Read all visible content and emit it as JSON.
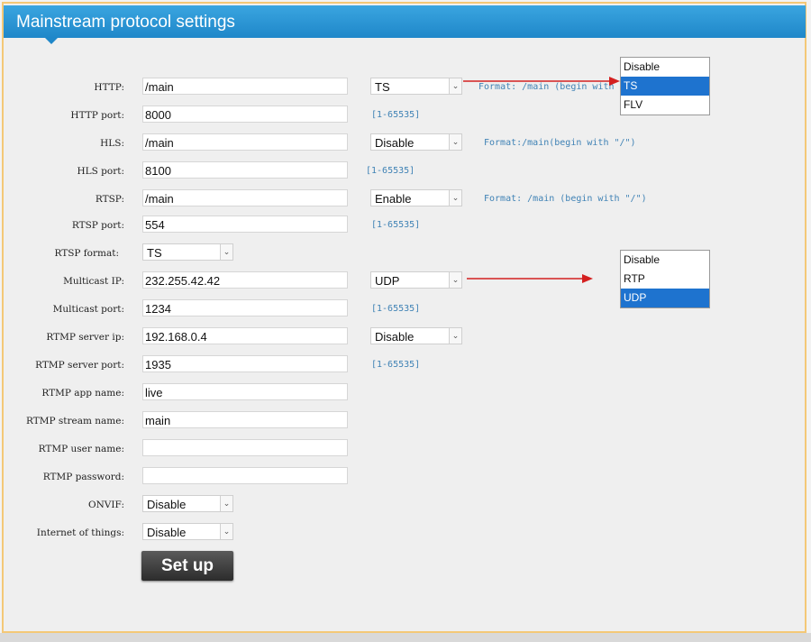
{
  "header": {
    "title": "Mainstream protocol settings"
  },
  "rows": [
    {
      "label": "HTTP:",
      "value": "/main"
    },
    {
      "label": "HTTP port:",
      "value": "8000"
    },
    {
      "label": "HLS:",
      "value": "/main"
    },
    {
      "label": "HLS port:",
      "value": "8100"
    },
    {
      "label": "RTSP:",
      "value": "/main"
    },
    {
      "label": "RTSP port:",
      "value": "554"
    },
    {
      "label": "RTSP format:",
      "value": "TS"
    },
    {
      "label": "Multicast IP:",
      "value": "232.255.42.42"
    },
    {
      "label": "Multicast port:",
      "value": "1234"
    },
    {
      "label": "RTMP server ip:",
      "value": "192.168.0.4"
    },
    {
      "label": "RTMP server port:",
      "value": "1935"
    },
    {
      "label": "RTMP app name:",
      "value": "live"
    },
    {
      "label": "RTMP stream name:",
      "value": "main"
    },
    {
      "label": "RTMP user name:",
      "value": ""
    },
    {
      "label": "RTMP password:",
      "value": ""
    },
    {
      "label": "ONVIF:",
      "value": "Disable"
    },
    {
      "label": "Internet of things:",
      "value": "Disable"
    }
  ],
  "selects": {
    "http_format": "TS",
    "hls_enable": "Disable",
    "rtsp_enable": "Enable",
    "multicast_proto": "UDP",
    "rtmp_enable": "Disable"
  },
  "hints": {
    "http": "Format: /main (begin with \"",
    "http_port": "[1-65535]",
    "hls": "Format:/main(begin with \"/\")",
    "hls_port": "[1-65535]",
    "rtsp": "Format: /main (begin with \"/\")",
    "rtsp_port": "[1-65535]",
    "multicast_port": "[1-65535]",
    "rtmp_port": "[1-65535]"
  },
  "dropdown_http": {
    "options": [
      "Disable",
      "TS",
      "FLV"
    ],
    "selected": "TS"
  },
  "dropdown_multicast": {
    "options": [
      "Disable",
      "RTP",
      "UDP"
    ],
    "selected": "UDP"
  },
  "setup_label": "Set up",
  "colors": {
    "header": "#2a97d6",
    "highlight": "#1e73cf",
    "arrow": "#d42020",
    "hint": "#3f82b5"
  }
}
